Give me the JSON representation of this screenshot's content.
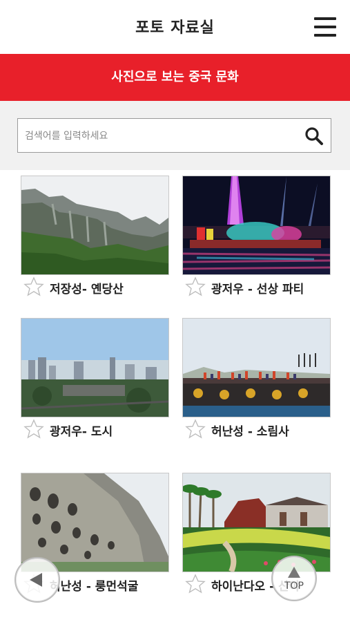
{
  "header": {
    "title": "포토 자료실",
    "menu_icon": "hamburger-menu-icon"
  },
  "banner": {
    "text": "사진으로 보는 중국 문화",
    "color": "#e8202a"
  },
  "search": {
    "placeholder": "검색어를 입력하세요",
    "value": "",
    "icon": "search-icon"
  },
  "gallery": {
    "items": [
      {
        "caption": "저장성- 옌당산",
        "image": "mountain-cliffs-photo"
      },
      {
        "caption": "광저우 - 선상 파티",
        "image": "night-boat-party-photo"
      },
      {
        "caption": "광저우- 도시",
        "image": "city-skyline-photo"
      },
      {
        "caption": "허난성 - 소림사",
        "image": "shaolin-performance-photo"
      },
      {
        "caption": "허난성 - 룽먼석굴",
        "image": "longmen-grottoes-photo"
      },
      {
        "caption": "하이난다오 - 산야",
        "image": "sanya-park-photo"
      }
    ]
  },
  "controls": {
    "prev_icon": "left-arrow-icon",
    "top_label": "TOP",
    "top_icon": "up-arrow-icon"
  }
}
